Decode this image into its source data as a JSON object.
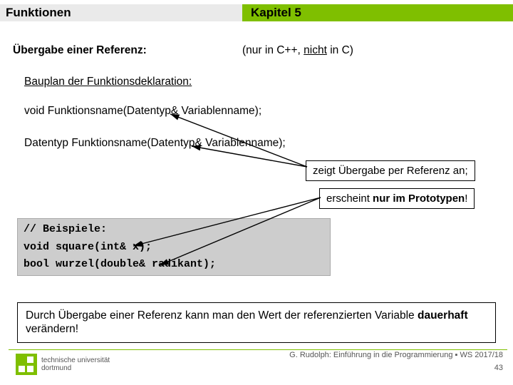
{
  "header": {
    "left": "Funktionen",
    "right": "Kapitel 5"
  },
  "subtitle": "Übergabe einer Referenz:",
  "lang_note": {
    "pre": "(nur in C++, ",
    "emph": "nicht",
    "post": " in C)"
  },
  "bauplan": "Bauplan der Funktionsdeklaration:",
  "decl1": "void Funktionsname(Datentyp& Variablenname);",
  "decl2": "Datentyp Funktionsname(Datentyp& Variablenname);",
  "box1": "zeigt Übergabe per Referenz an;",
  "box2": {
    "pre": "erscheint ",
    "bold": "nur im Prototypen",
    "post": "!"
  },
  "code": {
    "comment": "// Beispiele:",
    "line1": "void square(int& x);",
    "line2": "bool wurzel(double& radikant);"
  },
  "msg": {
    "pre": "Durch Übergabe einer Referenz kann man den Wert der referenzierten Variable ",
    "bold": "dauerhaft",
    "post": " verändern!"
  },
  "footer": {
    "uni1": "technische universität",
    "uni2": "dortmund",
    "credit": "G. Rudolph: Einführung in die Programmierung ▪ WS 2017/18",
    "page": "43"
  }
}
